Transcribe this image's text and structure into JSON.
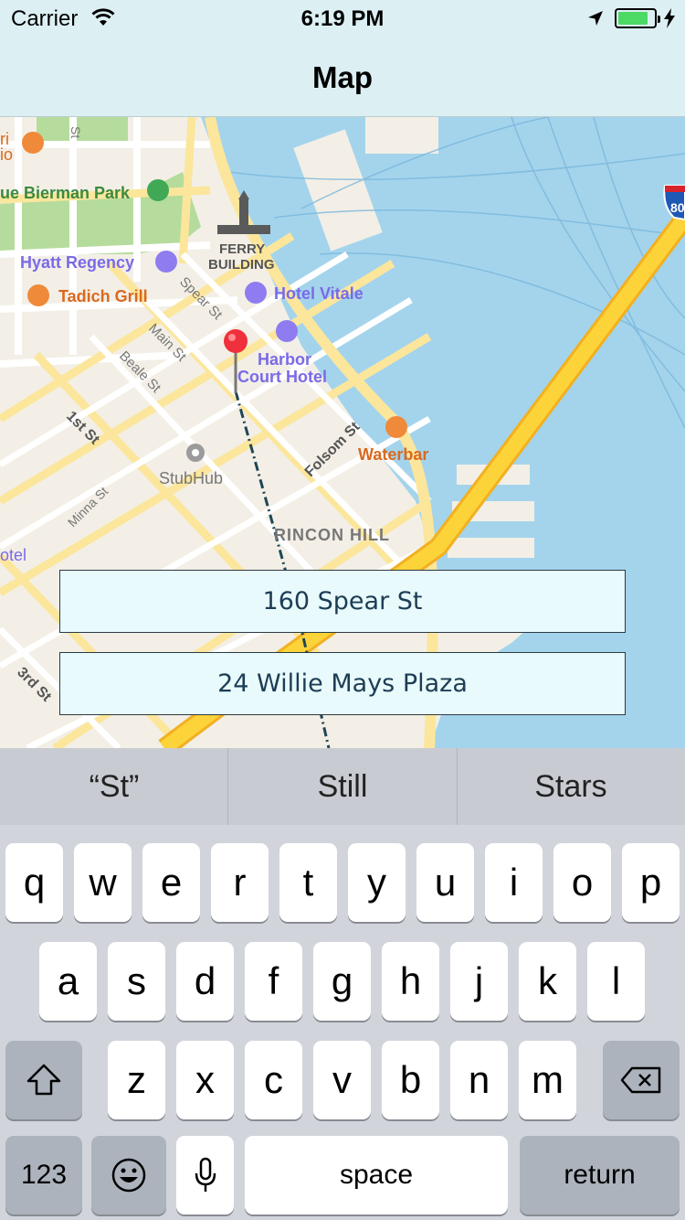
{
  "status_bar": {
    "carrier": "Carrier",
    "time": "6:19 PM",
    "battery_level": 0.85
  },
  "nav": {
    "title": "Map"
  },
  "map": {
    "labels": {
      "park": "ue Bierman Park",
      "hyatt": "Hyatt Regency",
      "tadich": "Tadich Grill",
      "ferry1": "FERRY",
      "ferry2": "BUILDING",
      "vitale": "Hotel Vitale",
      "harbor1": "Harbor",
      "harbor2": "Court Hotel",
      "waterbar": "Waterbar",
      "stubhub": "StubHub",
      "rincon": "RINCON HILL",
      "spear": "Spear St",
      "main": "Main St",
      "beale": "Beale St",
      "first": "1st St",
      "minna": "Minna St",
      "folsom": "Folsom St",
      "third": "3rd St",
      "hotel_left": "otel",
      "st_top": "St",
      "ri": "ri",
      "io": "io",
      "shield": "80"
    }
  },
  "addresses": {
    "origin": "160 Spear St",
    "destination": "24 Willie Mays Plaza"
  },
  "keyboard": {
    "suggestions": [
      "“St”",
      "Still",
      "Stars"
    ],
    "row1": [
      "q",
      "w",
      "e",
      "r",
      "t",
      "y",
      "u",
      "i",
      "o",
      "p"
    ],
    "row2": [
      "a",
      "s",
      "d",
      "f",
      "g",
      "h",
      "j",
      "k",
      "l"
    ],
    "row3": [
      "z",
      "x",
      "c",
      "v",
      "b",
      "n",
      "m"
    ],
    "numbers_label": "123",
    "space_label": "space",
    "return_label": "return"
  },
  "colors": {
    "water": "#a4d4ec",
    "land": "#f3efe6",
    "park": "#b5dc9c",
    "highway": "#fdd33a",
    "pin": "#f0303c",
    "route": "#1e4656",
    "address_bg": "#e8fafb",
    "address_text": "#1d3d55"
  }
}
